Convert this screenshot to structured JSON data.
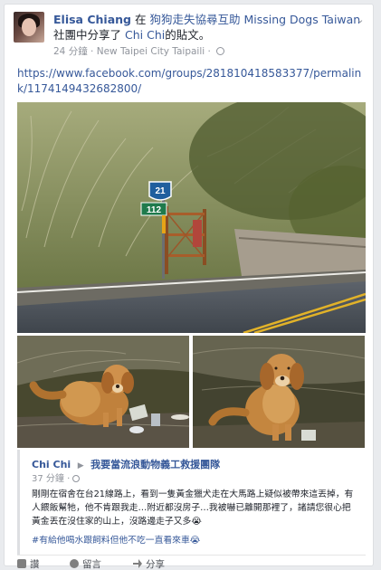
{
  "post": {
    "author": "Elisa Chiang",
    "text_in": "在",
    "group": "狗狗走失協尋互助 Missing Dogs Taiwan",
    "text_group_share": "社團中分享了",
    "shared_author": "Chi Chi",
    "text_post": "的貼文。",
    "time": "24 分鐘",
    "location": "New Taipei City Taipaili",
    "url": "https://www.facebook.com/groups/281810418583377/permalink/1174149432682800/"
  },
  "images": {
    "road_sign_top": "21",
    "road_sign_bottom": "112"
  },
  "shared": {
    "author": "Chi Chi",
    "page": "我要當流浪動物義工救援團隊",
    "time": "37 分鐘",
    "text": "剛剛在宿舍在台21線路上，看到一隻黃金獵犬走在大馬路上疑似被帶來這丟掉，有人餵飯幫牠，他不肯跟我走…附近都沒房子…我被嚇已離開那裡了，諸請您很心把黃金丟在沒住家的山上，沒路邊走子又多",
    "emoji1": "😭",
    "hashtag": "#有給他喝水跟飼料但他不吃一直看來車",
    "emoji2": "😭"
  },
  "actions": {
    "like": "讚",
    "comment": "留言",
    "share": "分享"
  },
  "colors": {
    "link": "#365899",
    "meta": "#90949c",
    "background": "#e9ebee"
  }
}
